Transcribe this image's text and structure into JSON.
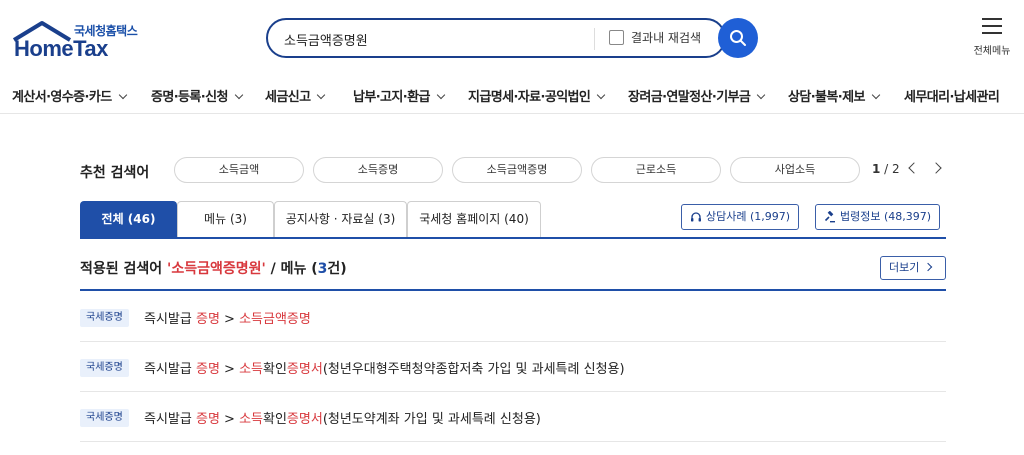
{
  "header": {
    "logo_kr": "국세청홈택스",
    "logo_en": "HomeTax",
    "search_value": "소득금액증명원",
    "research_label": "결과내 재검색",
    "menu_label": "전체메뉴"
  },
  "gnb": [
    "계산서·영수증·카드",
    "증명·등록·신청",
    "세금신고",
    "납부·고지·환급",
    "지급명세·자료·공익법인",
    "장려금·연말정산·기부금",
    "상담·불복·제보",
    "세무대리·납세관리"
  ],
  "recommend": {
    "title": "추천 검색어",
    "keywords": [
      "소득금액",
      "소득증명",
      "소득금액증명",
      "근로소득",
      "사업소득"
    ],
    "page_current": "1",
    "page_sep": " / ",
    "page_total": "2"
  },
  "tabs": [
    "전체 (46)",
    "메뉴 (3)",
    "공지사항 · 자료실 (3)",
    "국세청 홈페이지 (40)"
  ],
  "external": {
    "consult": "상담사례 (1,997)",
    "law": "법령정보 (48,397)"
  },
  "result": {
    "prefix": "적용된 검색어 ",
    "keyword": "'소득금액증명원'",
    "middle": " / 메뉴 (",
    "count": "3",
    "suffix": "건)",
    "more": "더보기"
  },
  "rows": [
    {
      "badge": "국세증명",
      "parts": [
        "즉시발급 ",
        "증명",
        " > ",
        "소득금액증명",
        ""
      ]
    },
    {
      "badge": "국세증명",
      "parts": [
        "즉시발급 ",
        "증명",
        " > ",
        "소득",
        "확인",
        "증명서",
        "(청년우대형주택청약종합저축 가입 및 과세특례 신청용)"
      ]
    },
    {
      "badge": "국세증명",
      "parts": [
        "즉시발급 ",
        "증명",
        " > ",
        "소득",
        "확인",
        "증명서",
        "(청년도약계좌 가입 및 과세특례 신청용)"
      ]
    }
  ],
  "colors": {
    "brand": "#1a3f8c",
    "accent": "#1f5fd6",
    "highlight": "#d8383d"
  }
}
